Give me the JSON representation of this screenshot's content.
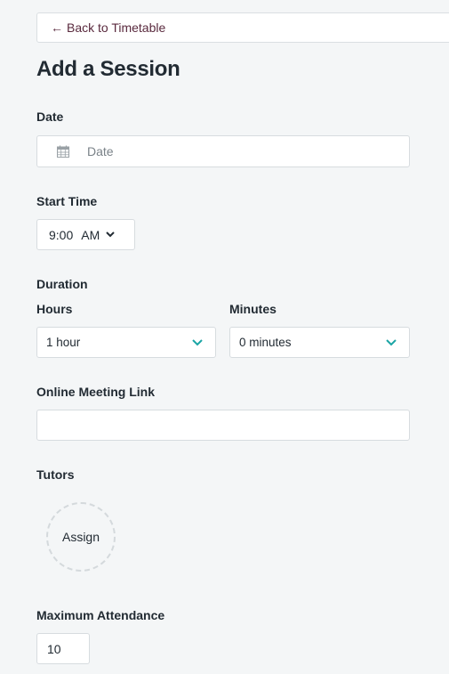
{
  "back": {
    "arrow": "←",
    "label": "Back to Timetable"
  },
  "page_title": "Add a Session",
  "date": {
    "label": "Date",
    "placeholder": "Date",
    "icon": "calendar-icon"
  },
  "start_time": {
    "label": "Start Time",
    "time": "9:00",
    "ampm": "AM"
  },
  "duration": {
    "label": "Duration",
    "hours_label": "Hours",
    "hours_value": "1 hour",
    "minutes_label": "Minutes",
    "minutes_value": "0 minutes"
  },
  "meeting_link": {
    "label": "Online Meeting Link",
    "value": ""
  },
  "tutors": {
    "label": "Tutors",
    "assign_label": "Assign"
  },
  "attendance": {
    "label": "Maximum Attendance",
    "value": "10"
  },
  "colors": {
    "accent": "#1ba5a5",
    "link": "#5a2a3e",
    "background": "#f4f6f7"
  }
}
